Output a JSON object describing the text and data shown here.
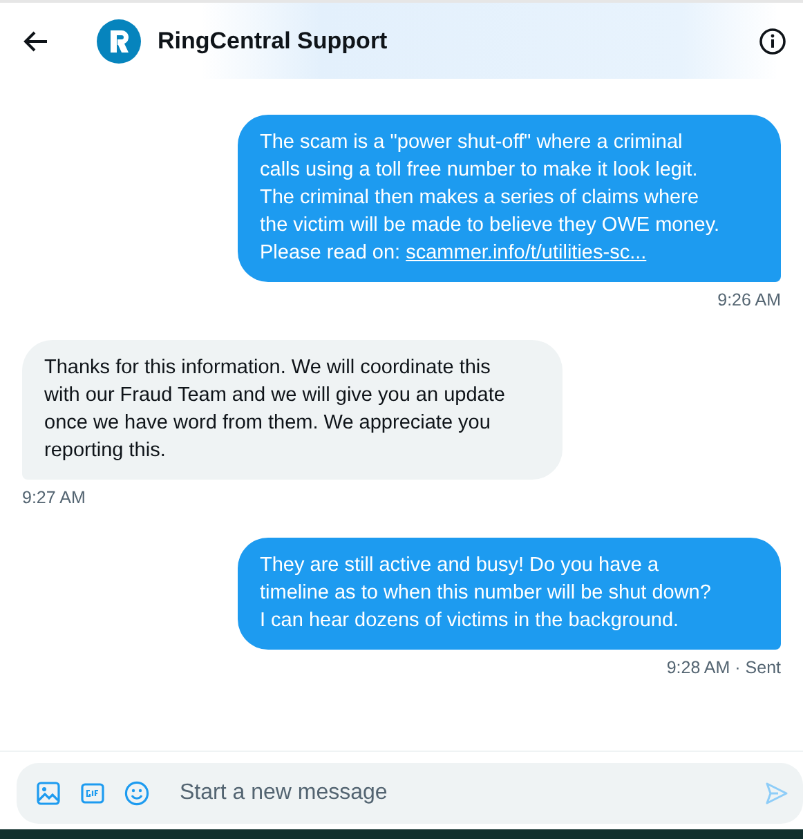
{
  "header": {
    "title": "RingCentral Support"
  },
  "messages": [
    {
      "kind": "sent",
      "text": "The scam is a \"power shut-off\" where a criminal calls using a toll free number to make it look legit. The criminal then makes a series of claims where the victim will be made to believe they OWE money. Please read on: ",
      "link": "scammer.info/t/utilities-sc...",
      "time": "9:26 AM"
    },
    {
      "kind": "received",
      "text": "Thanks for this information. We will coordinate this with our Fraud Team and we will give you an update once we have word from them. We appreciate you reporting this.",
      "time": "9:27 AM"
    },
    {
      "kind": "sent",
      "text": "They are still active and busy! Do you have a timeline as to when this number will be shut down? I can hear dozens of victims in the background.",
      "time": "9:28 AM · Sent"
    }
  ],
  "composer": {
    "placeholder": "Start a new message"
  }
}
